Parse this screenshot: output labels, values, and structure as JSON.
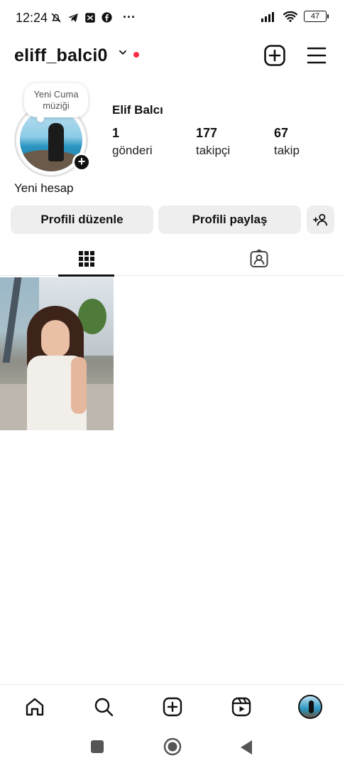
{
  "status_bar": {
    "time": "12:24",
    "more": "···",
    "battery": "47"
  },
  "header": {
    "username": "eliff_balci0"
  },
  "profile": {
    "note": "Yeni Cuma müziği",
    "full_name": "Elif Balcı",
    "stats": [
      {
        "value": "1",
        "label": "gönderi"
      },
      {
        "value": "177",
        "label": "takipçi"
      },
      {
        "value": "67",
        "label": "takip"
      }
    ],
    "bio": "Yeni hesap"
  },
  "actions": {
    "edit_profile": "Profili düzenle",
    "share_profile": "Profili paylaş"
  },
  "tabs": {
    "active": "posts"
  },
  "colors": {
    "notification_dot": "#ff2d46",
    "button_bg": "#eeeeef"
  },
  "icons": {
    "header": [
      "chevron-down-icon",
      "new-post-icon",
      "menu-icon"
    ],
    "tabs": [
      "grid-icon",
      "tagged-icon"
    ],
    "bottom_nav": [
      "home-icon",
      "search-icon",
      "create-icon",
      "reels-icon",
      "profile-avatar"
    ],
    "system_nav": [
      "recents-icon",
      "home-circle-icon",
      "back-icon"
    ]
  }
}
